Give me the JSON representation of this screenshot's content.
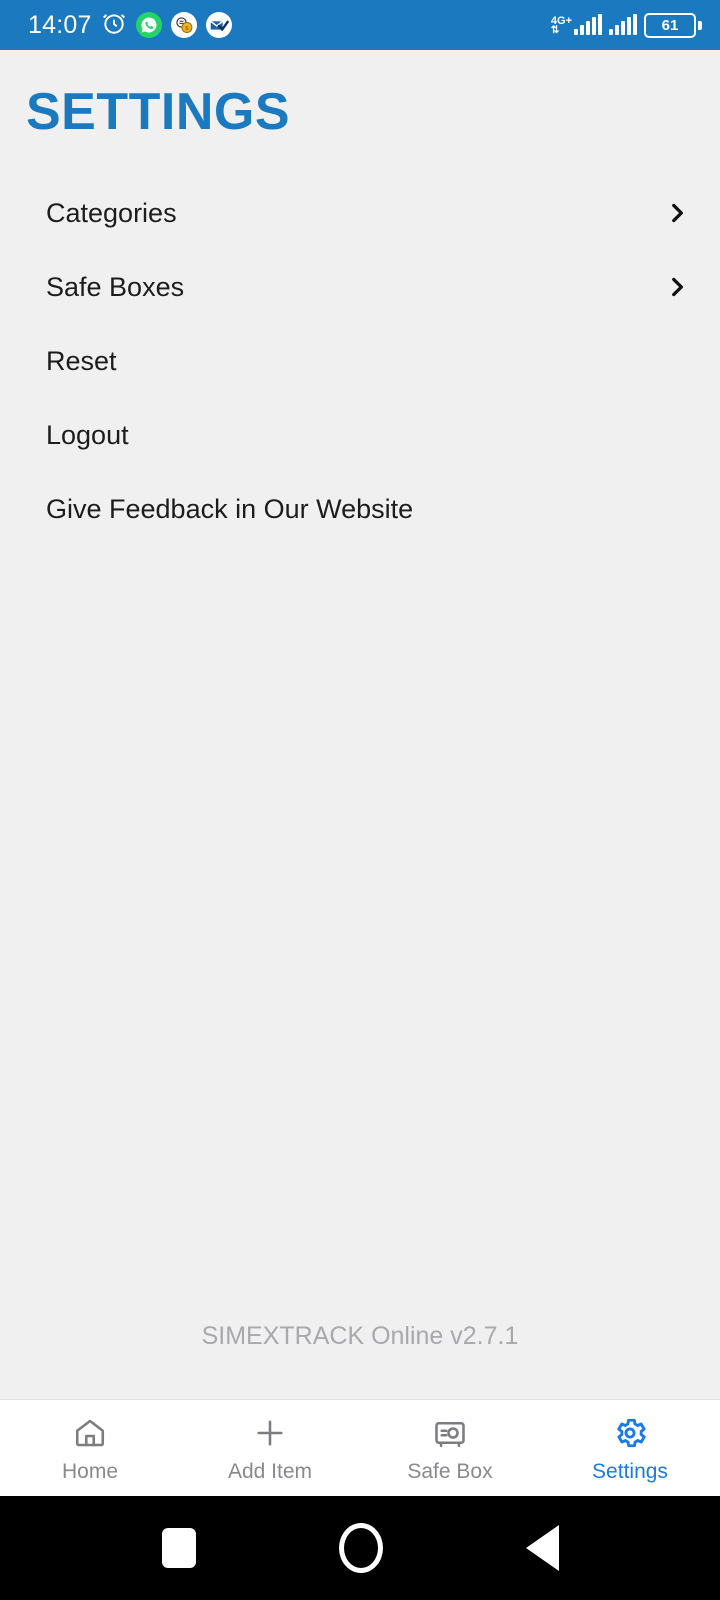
{
  "status_bar": {
    "time": "14:07",
    "battery_level": "61",
    "network_type": "4G+",
    "background_color": "#1b7abf",
    "icons": [
      "alarm-clock-icon",
      "whatsapp-icon",
      "money-app-icon",
      "check-mail-icon"
    ]
  },
  "header": {
    "title": "SETTINGS",
    "title_color": "#1b7abf"
  },
  "settings_list": [
    {
      "label": "Categories",
      "has_chevron": true
    },
    {
      "label": "Safe Boxes",
      "has_chevron": true
    },
    {
      "label": "Reset",
      "has_chevron": false
    },
    {
      "label": "Logout",
      "has_chevron": false
    },
    {
      "label": "Give Feedback in Our Website",
      "has_chevron": false
    }
  ],
  "footer": {
    "version_text": "SIMEXTRACK Online v2.7.1"
  },
  "tab_bar": {
    "active_color": "#1a7ae8",
    "inactive_color": "#8a8a8e",
    "tabs": [
      {
        "label": "Home",
        "icon": "home-icon",
        "active": false
      },
      {
        "label": "Add Item",
        "icon": "plus-icon",
        "active": false
      },
      {
        "label": "Safe Box",
        "icon": "safe-box-icon",
        "active": false
      },
      {
        "label": "Settings",
        "icon": "gear-icon",
        "active": true
      }
    ]
  },
  "android_nav": {
    "recents": "square-icon",
    "home": "circle-icon",
    "back": "triangle-icon"
  }
}
